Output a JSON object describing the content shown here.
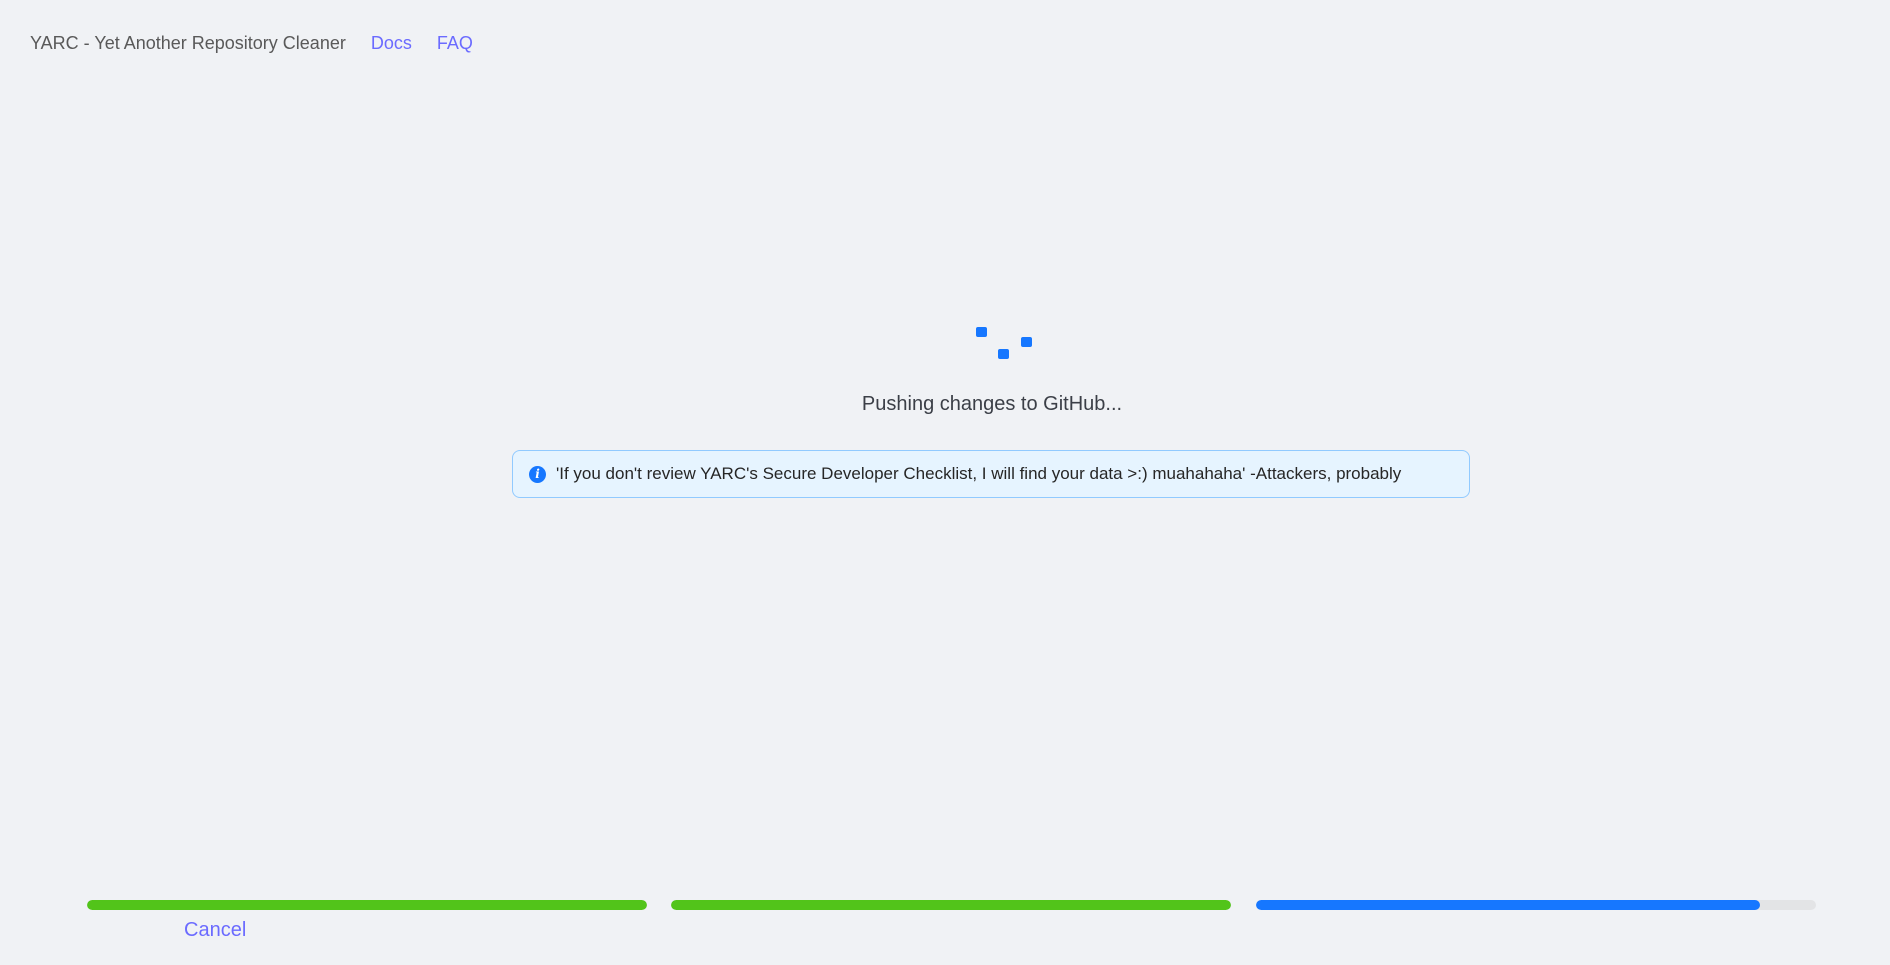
{
  "header": {
    "app_title": "YARC - Yet Another Repository Cleaner",
    "nav": [
      {
        "label": "Docs"
      },
      {
        "label": "FAQ"
      }
    ]
  },
  "main": {
    "status_text": "Pushing changes to GitHub...",
    "alert": {
      "icon": "info-icon",
      "message": "'If you don't review YARC's Secure Developer Checklist, I will find your data >:) muahahaha' -Attackers, probably"
    }
  },
  "progress": {
    "steps": [
      {
        "percent": 100,
        "color": "#52c41a"
      },
      {
        "percent": 100,
        "color": "#52c41a"
      },
      {
        "percent": 90,
        "color": "#1677ff"
      }
    ]
  },
  "footer": {
    "cancel_label": "Cancel"
  },
  "colors": {
    "accent": "#1677ff",
    "success": "#52c41a",
    "link": "#6b6bff",
    "background": "#f0f2f5"
  }
}
